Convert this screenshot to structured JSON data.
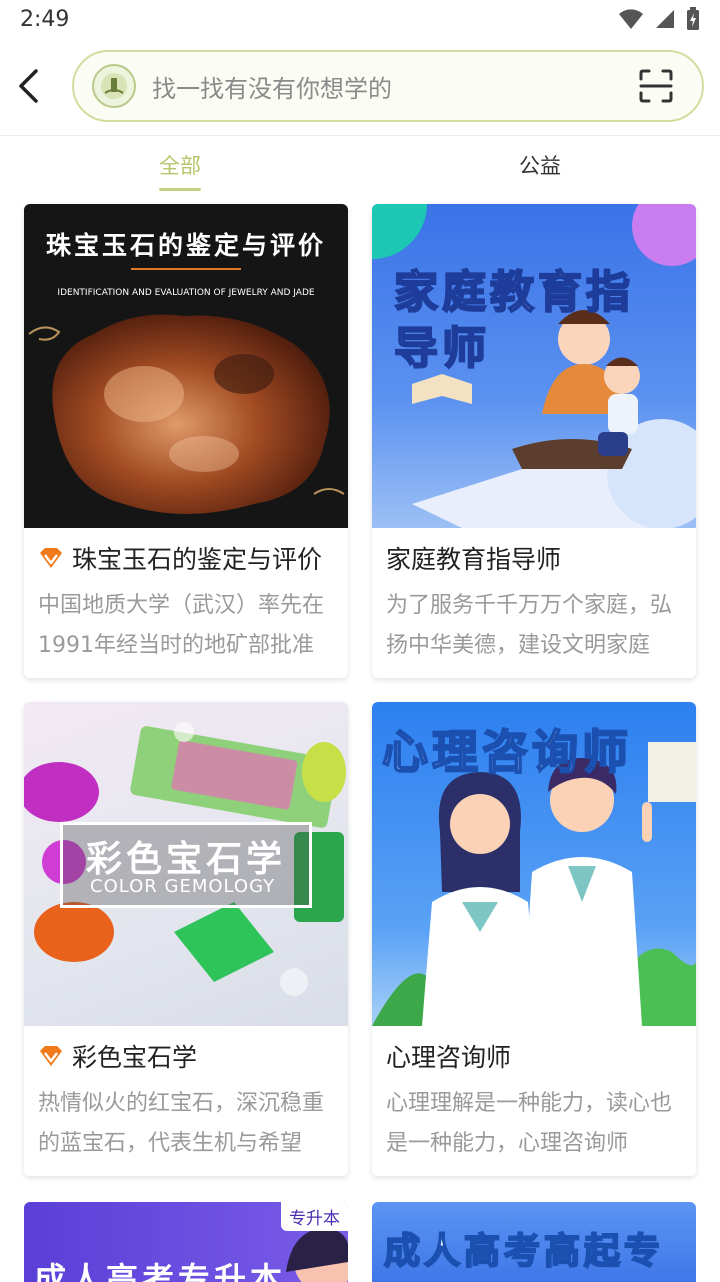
{
  "status": {
    "time": "2:49"
  },
  "search": {
    "placeholder": "找一找有没有你想学的"
  },
  "tabs": [
    {
      "label": "全部",
      "active": true
    },
    {
      "label": "公益",
      "active": false
    }
  ],
  "accent_color": "#b8c46a",
  "cards": [
    {
      "title": "珠宝玉石的鉴定与评价",
      "description": "中国地质大学（武汉）率先在1991年经当时的地矿部批准",
      "vip": true,
      "thumb_title": "珠宝玉石的鉴定与评价",
      "thumb_subtitle": "IDENTIFICATION AND EVALUATION OF JEWELRY AND JADE"
    },
    {
      "title": "家庭教育指导师",
      "description": "为了服务千千万万个家庭，弘扬中华美德，建设文明家庭",
      "vip": false,
      "thumb_title_line1": "家庭教育指",
      "thumb_title_line2": "导师"
    },
    {
      "title": "彩色宝石学",
      "description": "热情似火的红宝石，深沉稳重的蓝宝石，代表生机与希望",
      "vip": true,
      "thumb_title": "彩色宝石学",
      "thumb_subtitle": "COLOR GEMOLOGY"
    },
    {
      "title": "心理咨询师",
      "description": "心理理解是一种能力，读心也是一种能力，心理咨询师",
      "vip": false,
      "thumb_title": "心理咨询师"
    }
  ],
  "partial_cards": [
    {
      "badge": "专升本",
      "thumb_text": "成人高考专升本"
    },
    {
      "thumb_text": "成人高考高起专"
    }
  ]
}
